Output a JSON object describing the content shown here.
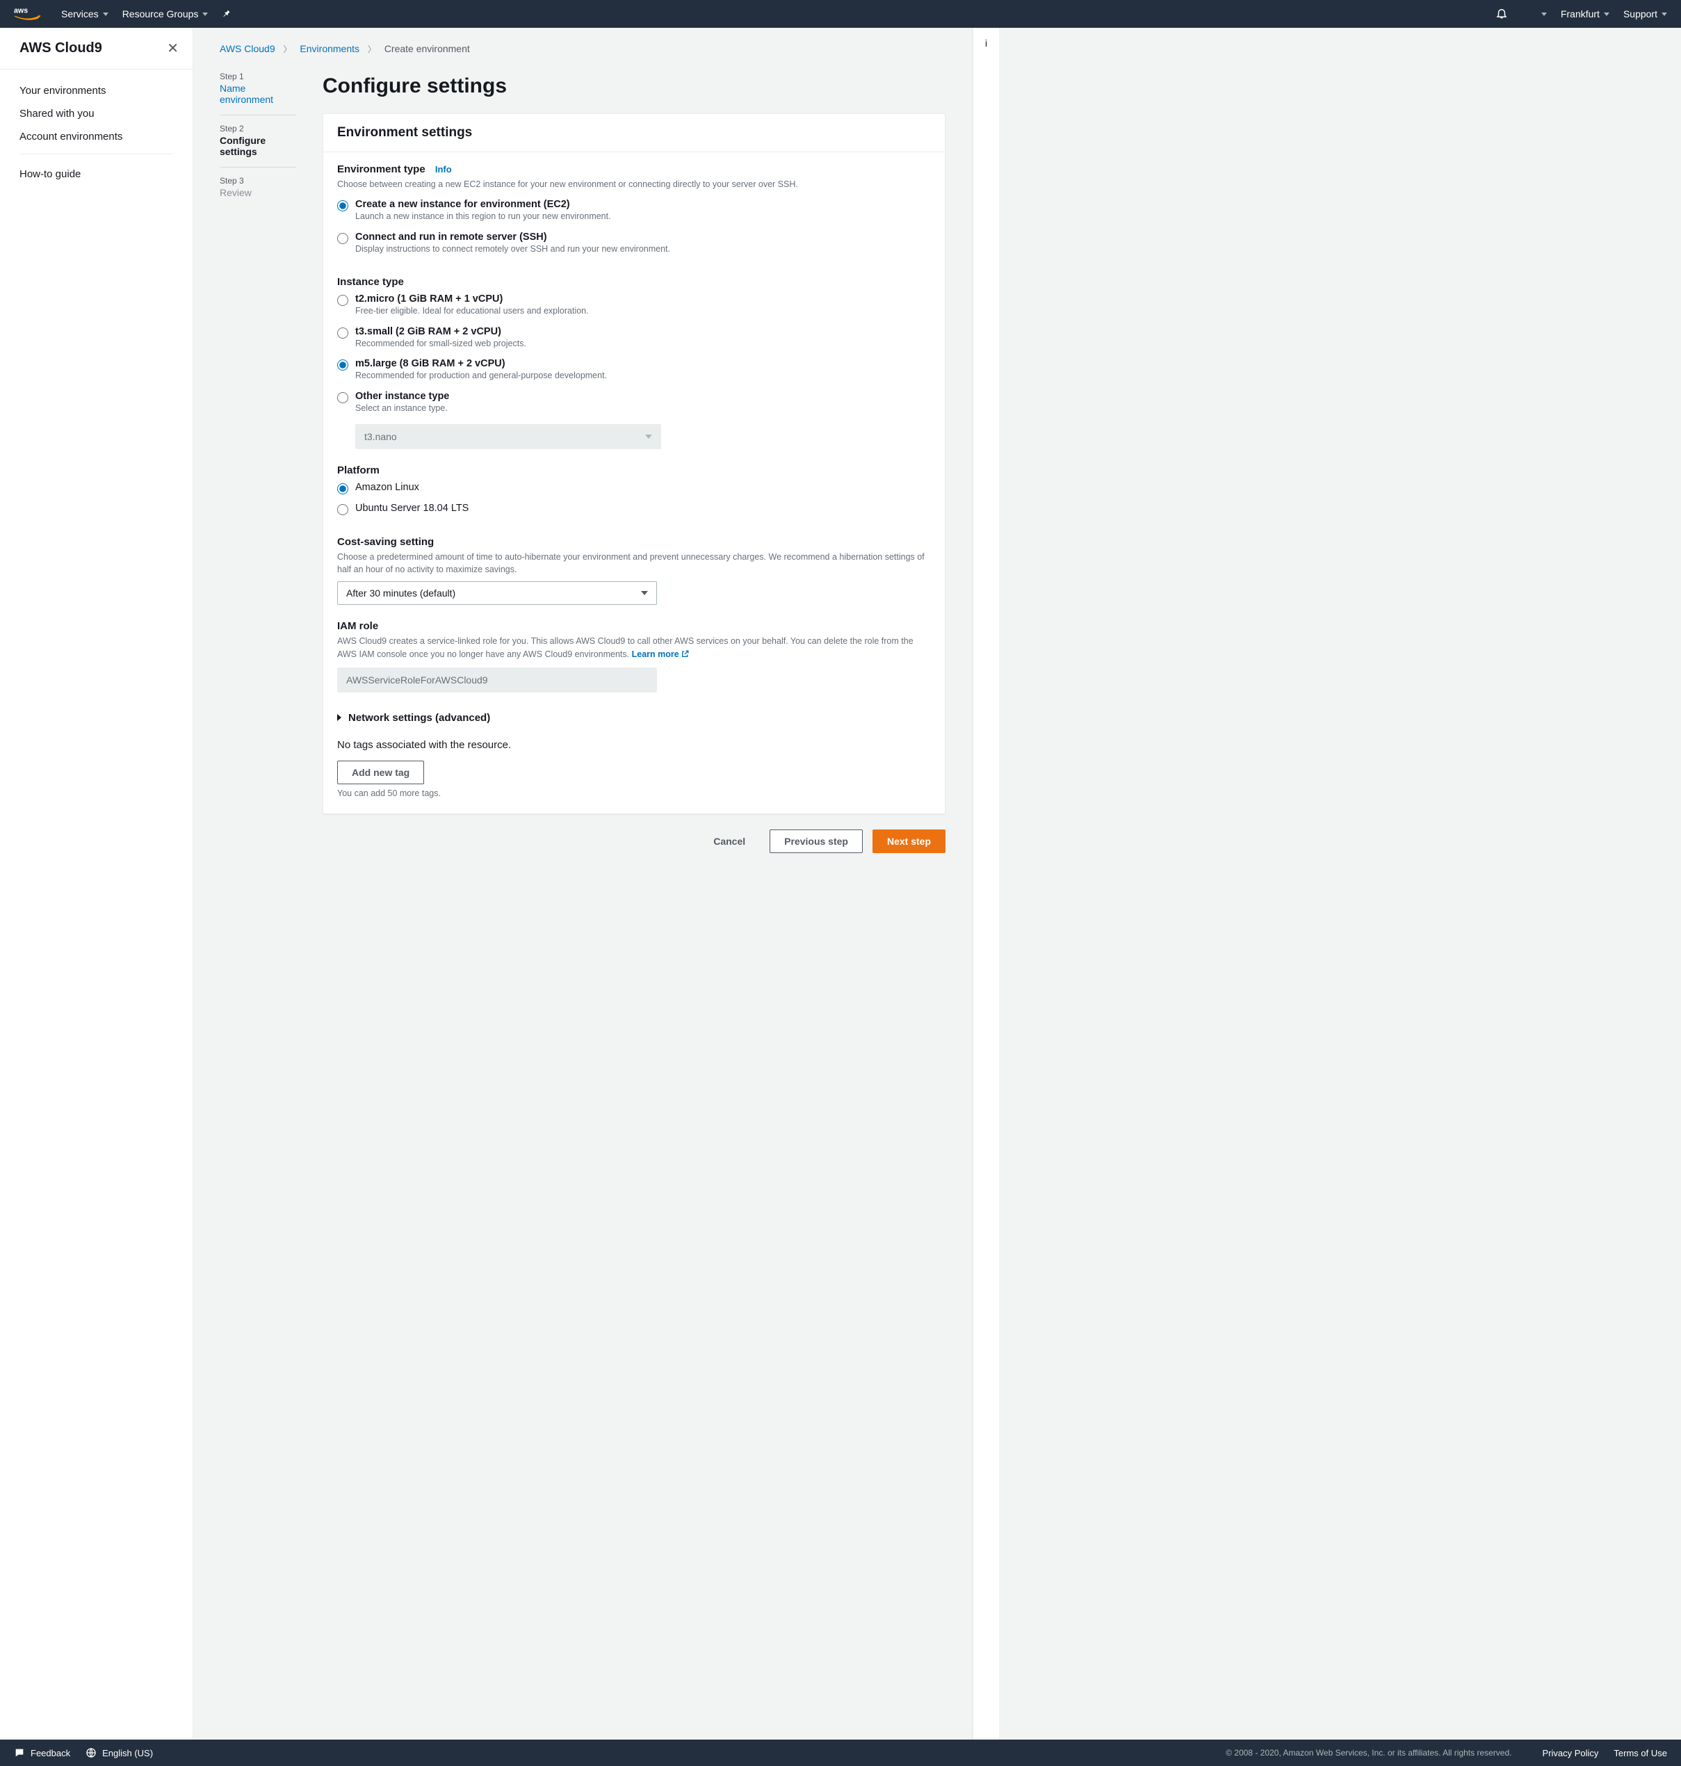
{
  "topnav": {
    "services": "Services",
    "resource_groups": "Resource Groups",
    "region": "Frankfurt",
    "support": "Support"
  },
  "sidebar": {
    "title": "AWS Cloud9",
    "links": {
      "your_env": "Your environments",
      "shared": "Shared with you",
      "account_env": "Account environments",
      "howto": "How-to guide"
    }
  },
  "breadcrumb": {
    "a": "AWS Cloud9",
    "b": "Environments",
    "c": "Create environment"
  },
  "steps": {
    "s1n": "Step 1",
    "s1t": "Name environment",
    "s2n": "Step 2",
    "s2t": "Configure settings",
    "s3n": "Step 3",
    "s3t": "Review"
  },
  "page_title": "Configure settings",
  "panel_title": "Environment settings",
  "env_type": {
    "label": "Environment type",
    "info": "Info",
    "desc": "Choose between creating a new EC2 instance for your new environment or connecting directly to your server over SSH.",
    "opt1_label": "Create a new instance for environment (EC2)",
    "opt1_desc": "Launch a new instance in this region to run your new environment.",
    "opt2_label": "Connect and run in remote server (SSH)",
    "opt2_desc": "Display instructions to connect remotely over SSH and run your new environment."
  },
  "instance": {
    "label": "Instance type",
    "o1l": "t2.micro (1 GiB RAM + 1 vCPU)",
    "o1d": "Free-tier eligible. Ideal for educational users and exploration.",
    "o2l": "t3.small (2 GiB RAM + 2 vCPU)",
    "o2d": "Recommended for small-sized web projects.",
    "o3l": "m5.large (8 GiB RAM + 2 vCPU)",
    "o3d": "Recommended for production and general-purpose development.",
    "o4l": "Other instance type",
    "o4d": "Select an instance type.",
    "other_val": "t3.nano"
  },
  "platform": {
    "label": "Platform",
    "o1": "Amazon Linux",
    "o2": "Ubuntu Server 18.04 LTS"
  },
  "cost": {
    "label": "Cost-saving setting",
    "desc": "Choose a predetermined amount of time to auto-hibernate your environment and prevent unnecessary charges. We recommend a hibernation settings of half an hour of no activity to maximize savings.",
    "value": "After 30 minutes (default)"
  },
  "iam": {
    "label": "IAM role",
    "desc": "AWS Cloud9 creates a service-linked role for you. This allows AWS Cloud9 to call other AWS services on your behalf. You can delete the role from the AWS IAM console once you no longer have any AWS Cloud9 environments. ",
    "learn": "Learn more",
    "value": "AWSServiceRoleForAWSCloud9"
  },
  "network_expand": "Network settings (advanced)",
  "tags": {
    "empty": "No tags associated with the resource.",
    "add": "Add new tag",
    "hint": "You can add 50 more tags."
  },
  "actions": {
    "cancel": "Cancel",
    "prev": "Previous step",
    "next": "Next step"
  },
  "footer": {
    "feedback": "Feedback",
    "language": "English (US)",
    "copy": "© 2008 - 2020, Amazon Web Services, Inc. or its affiliates. All rights reserved.",
    "privacy": "Privacy Policy",
    "terms": "Terms of Use"
  }
}
